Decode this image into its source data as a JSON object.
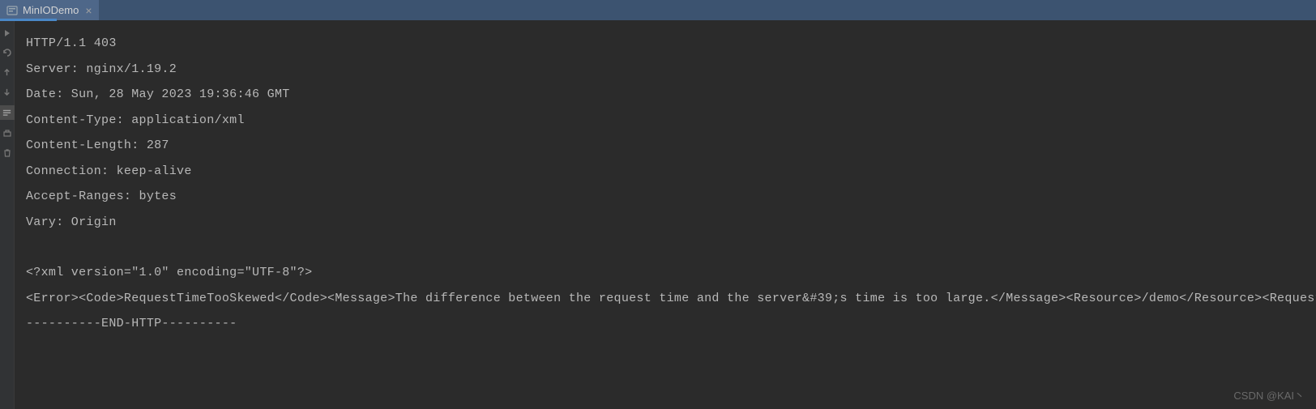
{
  "tab": {
    "title": "MinIODemo"
  },
  "console": {
    "lines": [
      "HTTP/1.1 403",
      "Server: nginx/1.19.2",
      "Date: Sun, 28 May 2023 19:36:46 GMT",
      "Content-Type: application/xml",
      "Content-Length: 287",
      "Connection: keep-alive",
      "Accept-Ranges: bytes",
      "Vary: Origin",
      "",
      "<?xml version=\"1.0\" encoding=\"UTF-8\"?>",
      "<Error><Code>RequestTimeTooSkewed</Code><Message>The difference between the request time and the server&#39;s time is too large.</Message><Resource>/demo</Resource><RequestId></",
      "----------END-HTTP----------"
    ]
  },
  "watermark": "CSDN @KAI丶"
}
